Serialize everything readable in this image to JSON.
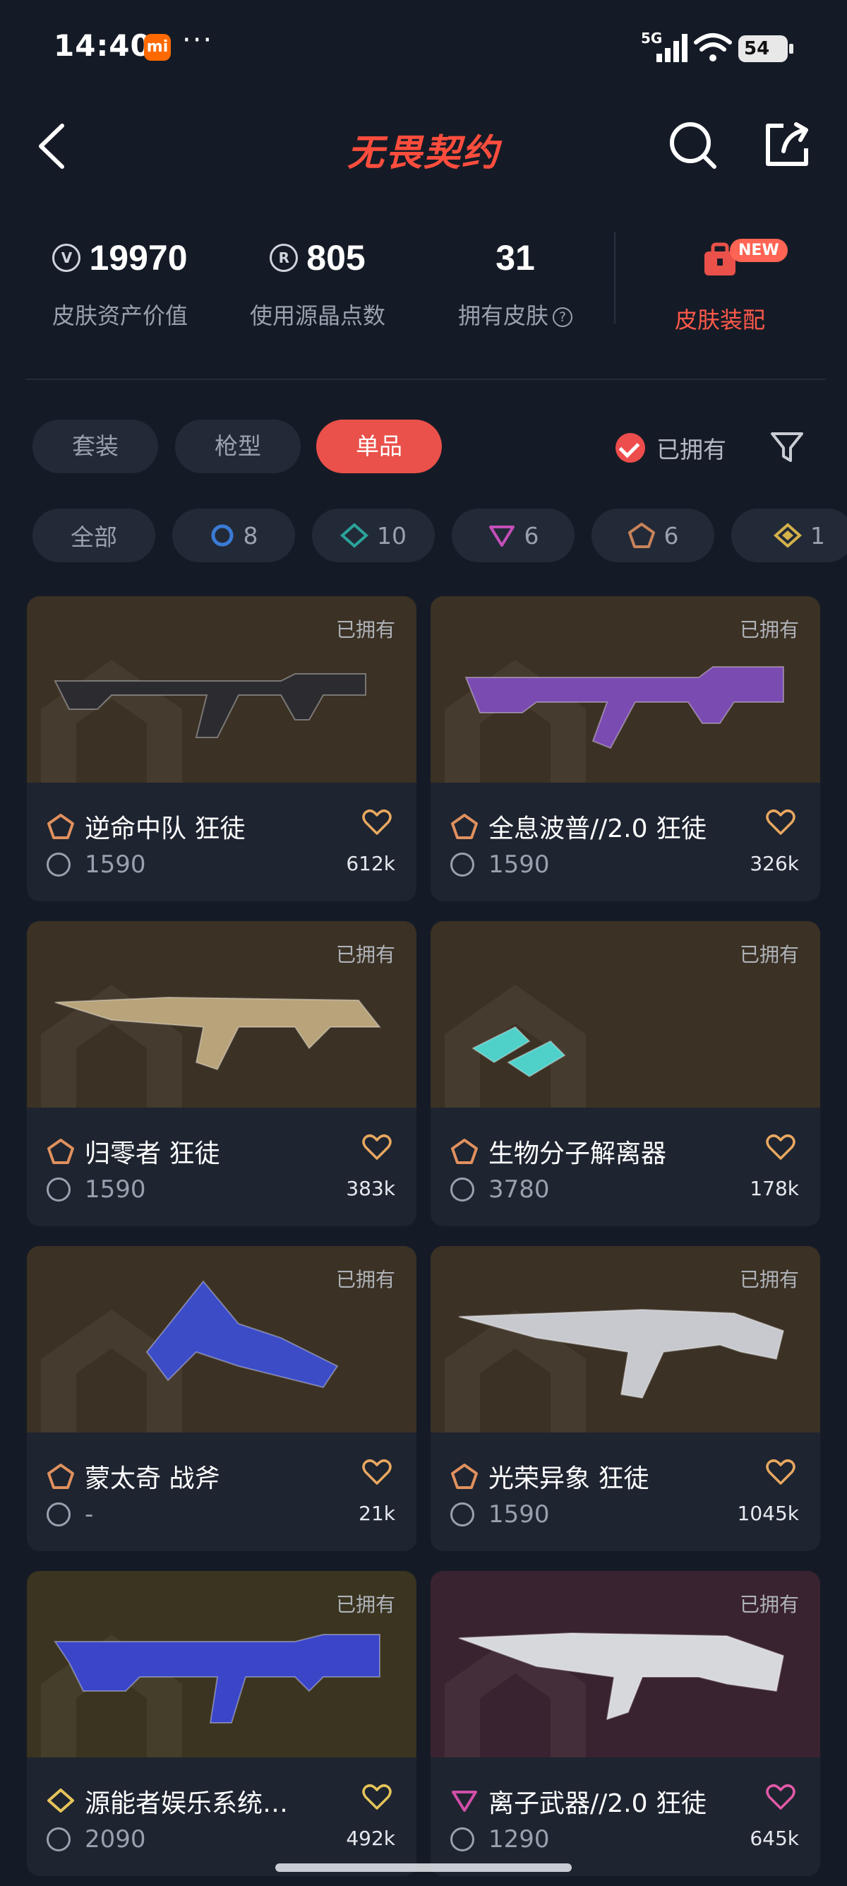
{
  "status_bar": {
    "time": "14:40",
    "mi_badge": "mi",
    "dots": "···",
    "network": "5G",
    "battery": "54"
  },
  "header": {
    "title": "无畏契约"
  },
  "stats": {
    "asset_value": "19970",
    "asset_label": "皮肤资产价值",
    "radianite_used": "805",
    "radianite_label": "使用源晶点数",
    "skins_owned": "31",
    "skins_label": "拥有皮肤",
    "help": "?",
    "equip_badge": "NEW",
    "equip_label": "皮肤装配"
  },
  "filters": {
    "tabs": [
      {
        "label": "套装",
        "active": false
      },
      {
        "label": "枪型",
        "active": false
      },
      {
        "label": "单品",
        "active": true
      }
    ],
    "owned_label": "已拥有"
  },
  "tiers": [
    {
      "label": "全部",
      "count": ""
    },
    {
      "label": "",
      "count": "8",
      "color": "#3a7bd5"
    },
    {
      "label": "",
      "count": "10",
      "color": "#2aa39a"
    },
    {
      "label": "",
      "count": "6",
      "color": "#c44fb8"
    },
    {
      "label": "",
      "count": "6",
      "color": "#c8835a"
    },
    {
      "label": "",
      "count": "1",
      "color": "#d4b24a"
    }
  ],
  "cards": [
    {
      "name": "逆命中队 狂徒",
      "price": "1590",
      "likes": "612k",
      "owned": "已拥有",
      "tier_color": "#e0905e",
      "heart_color": "#e8a860",
      "bg": "premium"
    },
    {
      "name": "全息波普//2.0 狂徒",
      "price": "1590",
      "likes": "326k",
      "owned": "已拥有",
      "tier_color": "#e0905e",
      "heart_color": "#e8a860",
      "bg": "premium"
    },
    {
      "name": "归零者 狂徒",
      "price": "1590",
      "likes": "383k",
      "owned": "已拥有",
      "tier_color": "#e0905e",
      "heart_color": "#e8a860",
      "bg": "premium"
    },
    {
      "name": "生物分子解离器",
      "price": "3780",
      "likes": "178k",
      "owned": "已拥有",
      "tier_color": "#e0905e",
      "heart_color": "#e8a860",
      "bg": "premium"
    },
    {
      "name": "蒙太奇 战斧",
      "price": "-",
      "likes": "21k",
      "owned": "已拥有",
      "tier_color": "#e0905e",
      "heart_color": "#e8a860",
      "bg": "premium"
    },
    {
      "name": "光荣异象 狂徒",
      "price": "1590",
      "likes": "1045k",
      "owned": "已拥有",
      "tier_color": "#e0905e",
      "heart_color": "#e8a860",
      "bg": "premium"
    },
    {
      "name": "源能者娱乐系统…",
      "price": "2090",
      "likes": "492k",
      "owned": "已拥有",
      "tier_color": "#e5c45a",
      "heart_color": "#e5c45a",
      "bg": "exclusive"
    },
    {
      "name": "离子武器//2.0 狂徒",
      "price": "1290",
      "likes": "645k",
      "owned": "已拥有",
      "tier_color": "#d04fa8",
      "heart_color": "#e15aa8",
      "bg": "ultra"
    }
  ]
}
